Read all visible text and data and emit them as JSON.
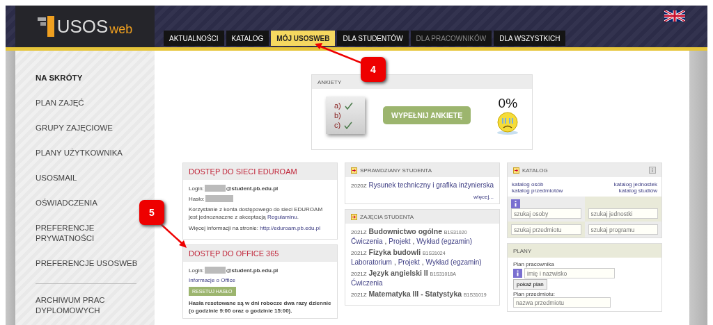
{
  "header": {
    "logo_main": "USOS",
    "logo_sub": "web"
  },
  "tabs": [
    {
      "label": "AKTUALNOŚCI",
      "selected": false,
      "disabled": false
    },
    {
      "label": "KATALOG",
      "selected": false,
      "disabled": false
    },
    {
      "label": "MÓJ USOSWEB",
      "selected": true,
      "disabled": false
    },
    {
      "label": "DLA STUDENTÓW",
      "selected": false,
      "disabled": false
    },
    {
      "label": "DLA PRACOWNIKÓW",
      "selected": false,
      "disabled": true
    },
    {
      "label": "DLA WSZYSTKICH",
      "selected": false,
      "disabled": false
    }
  ],
  "sidebar": {
    "items": [
      {
        "label": "NA SKRÓTY",
        "selected": true
      },
      {
        "label": "PLAN ZAJĘĆ",
        "selected": false
      },
      {
        "label": "GRUPY ZAJĘCIOWE",
        "selected": false
      },
      {
        "label": "PLANY UŻYTKOWNIKA",
        "selected": false
      },
      {
        "label": "USOSMAIL",
        "selected": false
      },
      {
        "label": "OŚWIADCZENIA",
        "selected": false
      },
      {
        "label": "PREFERENCJE PRYWATNOŚCI",
        "selected": false
      },
      {
        "label": "PREFERENCJE USOSWEB",
        "selected": false
      }
    ],
    "after_divider": [
      {
        "label": "ARCHIWUM PRAC DYPLOMOWYCH",
        "selected": false
      }
    ]
  },
  "survey": {
    "title": "ANKIETY",
    "checklist": [
      {
        "label": "a)",
        "checked": true
      },
      {
        "label": "b)",
        "checked": false
      },
      {
        "label": "c)",
        "checked": true
      }
    ],
    "button": "WYPEŁNIJ ANKIETĘ",
    "percent": "0%"
  },
  "eduroam": {
    "title": "DOSTĘP DO SIECI EDUROAM",
    "login_label": "Login:",
    "login_suffix": "@student.pb.edu.pl",
    "password_label": "Hasło:",
    "terms_text": "Korzystanie z konta dostępowego do sieci EDUROAM jest jednoznaczne z akceptacją",
    "terms_link": "Regulaminu",
    "terms_end": ".",
    "info_text": "Więcej informacji na stronie:",
    "info_link": "http://eduroam.pb.edu.pl"
  },
  "office": {
    "title": "DOSTĘP DO OFFICE 365",
    "login_label": "Login:",
    "login_suffix": "@student.pb.edu.pl",
    "info_link": "Informacje o Office",
    "reset_button": "RESETUJ HASŁO",
    "note": "Hasła resetowane są w dni robocze dwa razy dziennie (o godzinie 9:00 oraz o godzinie 15:00)."
  },
  "tests": {
    "title": "SPRAWDZIANY STUDENTA",
    "items": [
      {
        "term": "2020Z",
        "name": "Rysunek techniczny i grafika inżynierska"
      }
    ],
    "more": "więcej..."
  },
  "classes": {
    "title": "ZAJĘCIA STUDENTA",
    "separator": ",",
    "items": [
      {
        "term": "2021Z",
        "name": "Budownictwo ogólne",
        "code": "B1S31020",
        "activities": [
          "Ćwiczenia",
          "Projekt",
          "Wykład (egzamin)"
        ]
      },
      {
        "term": "2021Z",
        "name": "Fizyka budowli",
        "code": "B1S31024",
        "activities": [
          "Laboratorium",
          "Projekt",
          "Wykład (egzamin)"
        ]
      },
      {
        "term": "2021Z",
        "name": "Język angielski II",
        "code": "B1S31018A",
        "activities": [
          "Ćwiczenia"
        ]
      },
      {
        "term": "2021Z",
        "name": "Matematyka III - Statystyka",
        "code": "B1S31019"
      }
    ]
  },
  "catalog": {
    "title": "KATALOG",
    "links": [
      "katalog osób",
      "katalog jednostek",
      "katalog przedmiotów",
      "katalog studiów"
    ],
    "search_fields": [
      {
        "placeholder": "szukaj osoby"
      },
      {
        "placeholder": "szukaj jednostki"
      },
      {
        "placeholder": "szukaj przedmiotu"
      },
      {
        "placeholder": "szukaj programu"
      }
    ]
  },
  "plans": {
    "title": "PLANY",
    "employee_label": "Plan pracownika",
    "employee_placeholder": "imię i nazwisko",
    "show_button": "pokaż plan",
    "subject_label": "Plan przedmiotu:",
    "subject_placeholder": "nazwa przedmiotu"
  },
  "callouts": [
    {
      "number": "4"
    },
    {
      "number": "5"
    }
  ]
}
